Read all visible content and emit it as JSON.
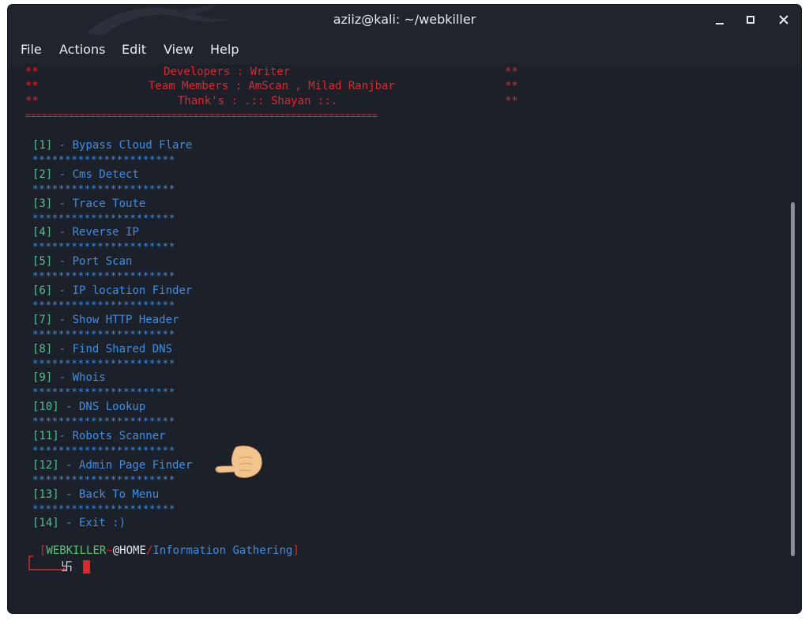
{
  "window": {
    "title": "aziiz@kali: ~/webkiller",
    "controls": {
      "minimize": "–",
      "maximize": "▫",
      "close": "✕"
    }
  },
  "menu": [
    "File",
    "Actions",
    "Edit",
    "View",
    "Help"
  ],
  "banner": {
    "developers": "Developers : Writer",
    "team": "Team Members : AmScan , Milad Ranjbar",
    "thanks": "Thank's : .:: Shayan ::.",
    "stars": "**",
    "separator": "================================================================="
  },
  "options": [
    {
      "num": "[1]",
      "label": " - Bypass Cloud Flare"
    },
    {
      "num": "[2]",
      "label": " - Cms Detect"
    },
    {
      "num": "[3]",
      "label": " - Trace Toute"
    },
    {
      "num": "[4]",
      "label": " - Reverse IP"
    },
    {
      "num": "[5]",
      "label": " - Port Scan"
    },
    {
      "num": "[6]",
      "label": " - IP location Finder"
    },
    {
      "num": "[7]",
      "label": " - Show HTTP Header"
    },
    {
      "num": "[8]",
      "label": " - Find Shared DNS"
    },
    {
      "num": "[9]",
      "label": " - Whois"
    },
    {
      "num": "[10]",
      "label": " - DNS Lookup"
    },
    {
      "num": "[11]",
      "label": "- Robots Scanner"
    },
    {
      "num": "[12]",
      "label": " - Admin Page Finder"
    },
    {
      "num": "[13]",
      "label": " - Back To Menu"
    },
    {
      "num": "[14]",
      "label": " - Exit :)"
    }
  ],
  "divider": "**********************",
  "prompt": {
    "open": "[",
    "name": "WEBKILLER",
    "tilde": "~",
    "host": "@HOME",
    "slash": "/",
    "path": "Information Gathering",
    "close": "]",
    "symbol": "卐"
  },
  "colors": {
    "background": "#1c2029",
    "banner": "#e0262b",
    "option_label": "#3c8ee6",
    "option_number": "#4fc08d",
    "prompt_name": "#52c96f",
    "cursor": "#e0262b"
  },
  "icons": {
    "pointing_hand": "pointing-hand-icon",
    "kali_logo": "kali-dragon-icon"
  }
}
